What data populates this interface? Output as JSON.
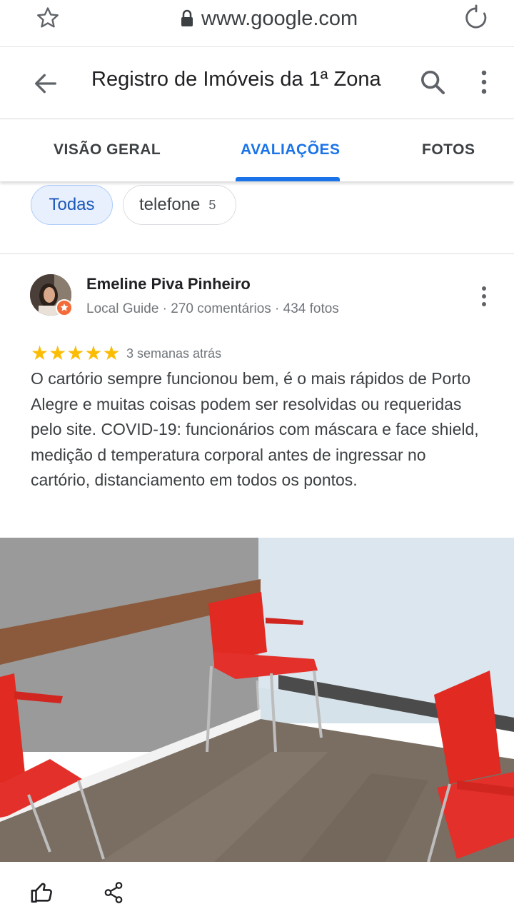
{
  "browser": {
    "url": "www.google.com"
  },
  "header": {
    "title": "Registro de Imóveis da 1ª Zona"
  },
  "tabs": [
    {
      "label": "VISÃO GERAL"
    },
    {
      "label": "AVALIAÇÕES",
      "active": true
    },
    {
      "label": "FOTOS"
    }
  ],
  "chips": [
    {
      "label": "Todas",
      "selected": true
    },
    {
      "label": "telefone",
      "count": "5"
    }
  ],
  "review": {
    "author": "Emeline Piva Pinheiro",
    "meta": "Local Guide · 270 comentários · 434 fotos",
    "rating": 5,
    "time": "3 semanas atrás",
    "text": "O cartório sempre funcionou bem, é o mais rápidos de Porto Alegre e muitas coisas podem ser resolvidas ou requeridas pelo site. COVID-19: funcionários com máscara e face shield, medição d temperatura corporal antes de ingressar no cartório, distanciamento em todos os pontos."
  },
  "colors": {
    "accent": "#1a73e8",
    "star": "#fbbc04",
    "chair": "#e02a22"
  }
}
